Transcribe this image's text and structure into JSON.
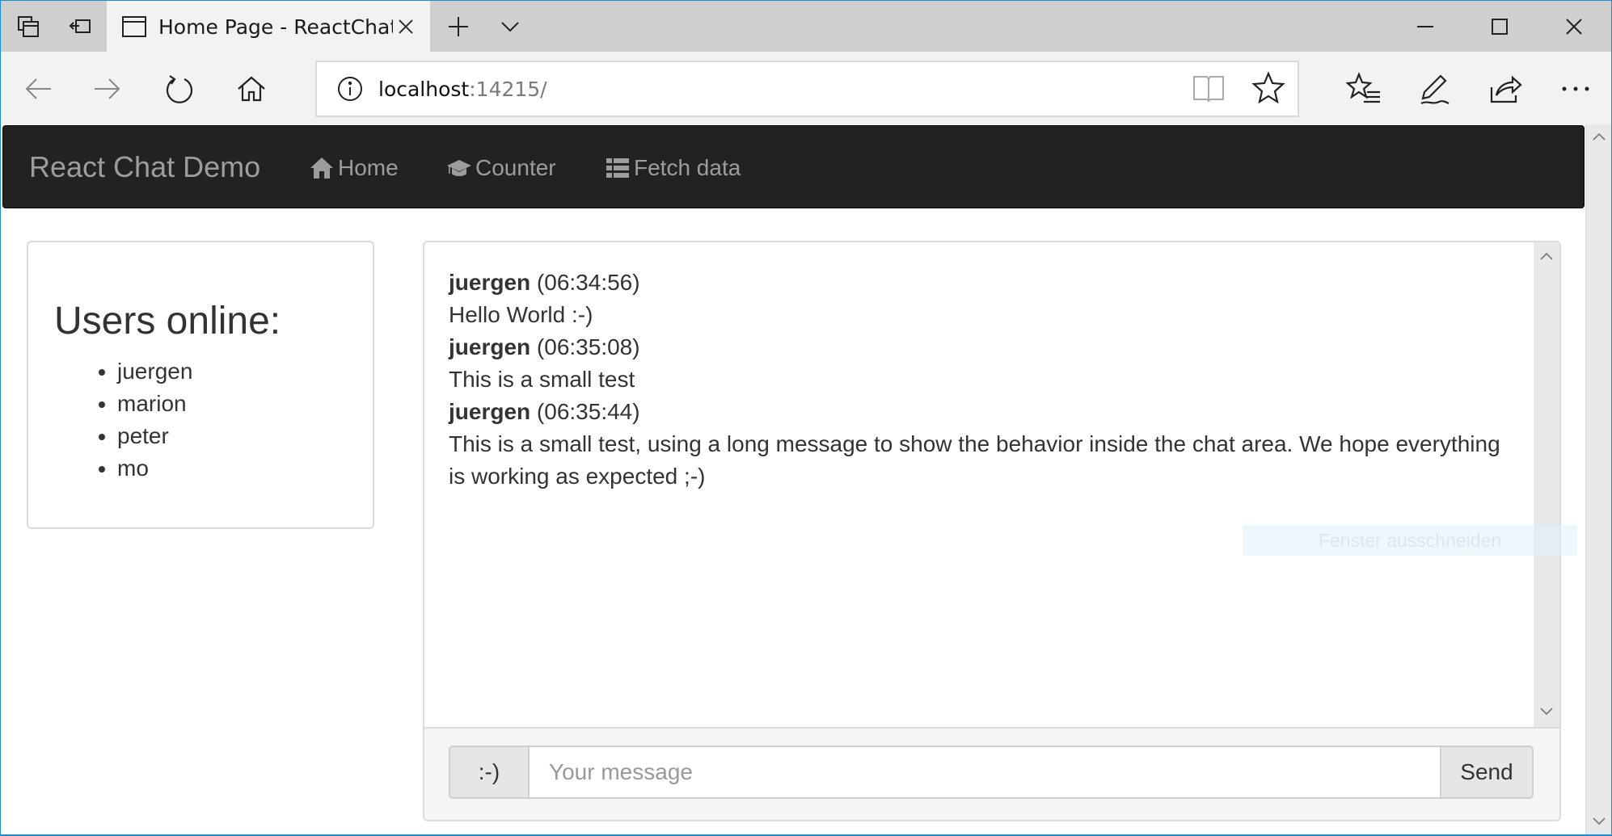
{
  "browser": {
    "tab_title": "Home Page - ReactChat",
    "url_host": "localhost",
    "url_rest": ":14215/"
  },
  "navbar": {
    "brand": "React Chat Demo",
    "links": [
      {
        "label": "Home",
        "icon": "home-icon"
      },
      {
        "label": "Counter",
        "icon": "graduation-cap-icon"
      },
      {
        "label": "Fetch data",
        "icon": "th-list-icon"
      }
    ]
  },
  "users": {
    "title": "Users online:",
    "list": [
      "juergen",
      "marion",
      "peter",
      "mo"
    ]
  },
  "chat": {
    "messages": [
      {
        "user": "juergen",
        "time": "(06:34:56)",
        "text": "Hello World :-)"
      },
      {
        "user": "juergen",
        "time": "(06:35:08)",
        "text": "This is a small test"
      },
      {
        "user": "juergen",
        "time": "(06:35:44)",
        "text": "This is a small test, using a long message to show the behavior inside the chat area. We hope everything is working as expected ;-)"
      }
    ],
    "emoji_label": ":-)",
    "input_placeholder": "Your message",
    "send_label": "Send"
  },
  "overlay": {
    "snip_tip": "Fenster ausschneiden"
  }
}
